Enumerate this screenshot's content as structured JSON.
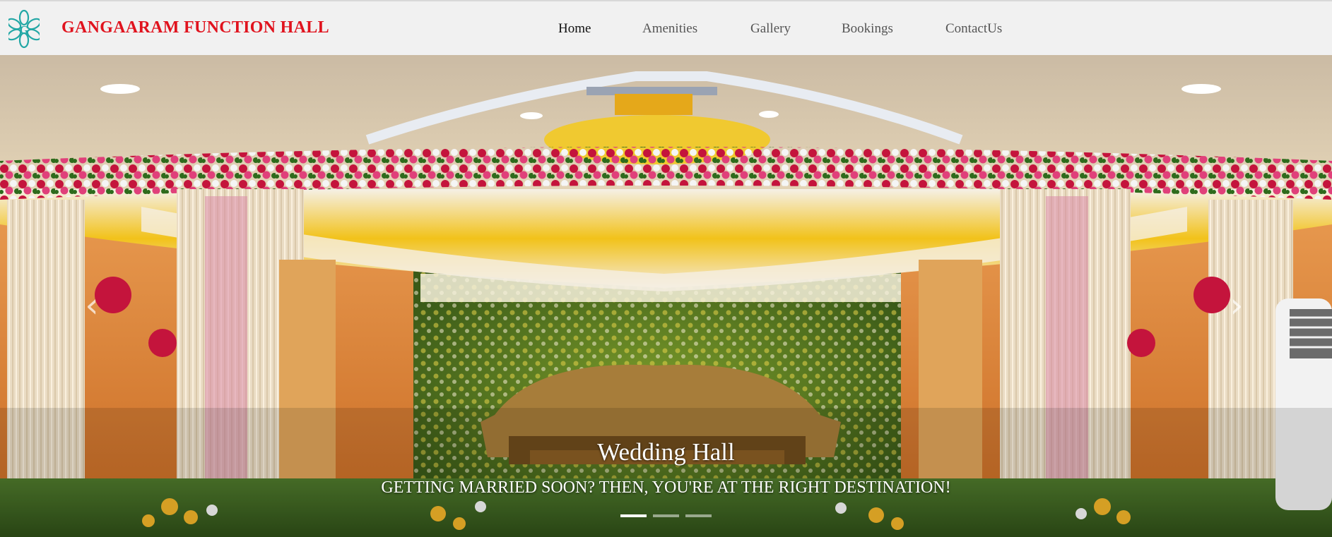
{
  "header": {
    "brand": "GANGAARAM FUNCTION HALL",
    "logo_icon": "flower-g-logo-icon",
    "brand_color": "#e0131e",
    "nav": [
      {
        "label": "Home",
        "active": true
      },
      {
        "label": "Amenities",
        "active": false
      },
      {
        "label": "Gallery",
        "active": false
      },
      {
        "label": "Bookings",
        "active": false
      },
      {
        "label": "ContactUs",
        "active": false
      }
    ]
  },
  "carousel": {
    "title": "Wedding Hall",
    "subtitle": "GETTING MARRIED SOON? THEN, YOU'RE AT THE RIGHT DESTINATION!",
    "prev_icon": "chevron-left-icon",
    "next_icon": "chevron-right-icon",
    "indicators": [
      {
        "active": true
      },
      {
        "active": false
      },
      {
        "active": false
      }
    ]
  }
}
